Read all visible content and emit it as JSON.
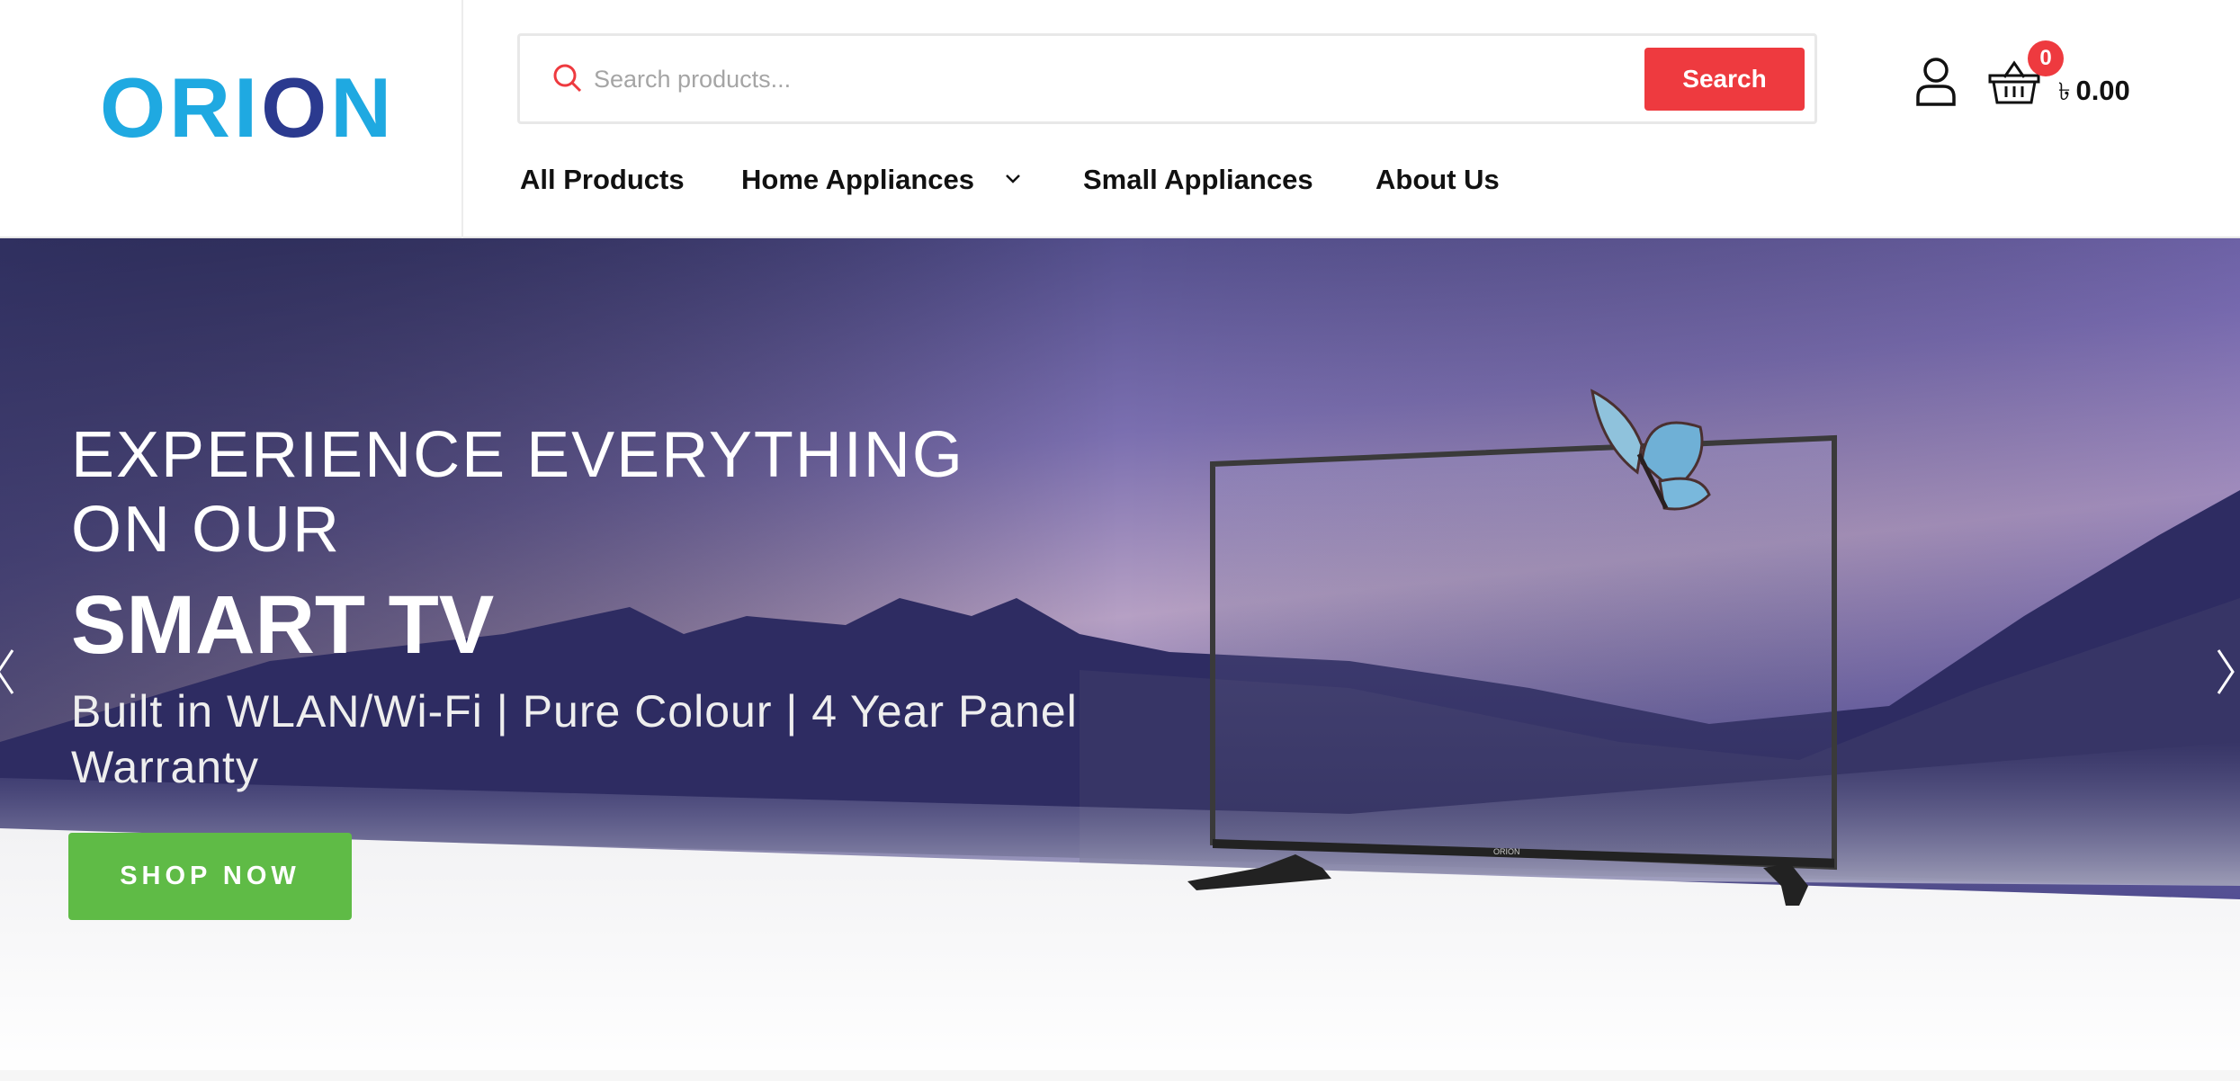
{
  "header": {
    "logo": {
      "text_a": "ORI",
      "text_b": "O",
      "text_c": "N"
    },
    "search": {
      "placeholder": "Search products...",
      "button_label": "Search"
    },
    "cart": {
      "count": "0",
      "currency": "৳",
      "total": "0.00"
    },
    "nav": [
      {
        "label": "All Products"
      },
      {
        "label": "Home Appliances"
      },
      {
        "label": "Small Appliances"
      },
      {
        "label": "About Us"
      }
    ]
  },
  "hero": {
    "line1": "EXPERIENCE EVERYTHING",
    "line2": "ON OUR",
    "line3": "SMART TV",
    "subtitle": "Built in WLAN/Wi-Fi | Pure Colour | 4 Year Panel Warranty",
    "cta": "SHOP NOW",
    "tv_brand": "ORION"
  },
  "colors": {
    "brand_blue": "#1fa9e1",
    "brand_navy": "#2b3a8f",
    "accent_red": "#ee3a3f",
    "cta_green": "#5fbb46"
  }
}
